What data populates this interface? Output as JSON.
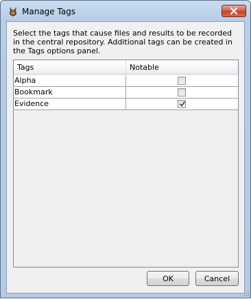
{
  "window": {
    "title": "Manage Tags",
    "close_glyph": "×"
  },
  "description": "Select the tags that cause files and results to be recorded in the central repository. Additional tags can be created in the Tags options panel.",
  "table": {
    "columns": [
      "Tags",
      "Notable"
    ],
    "rows": [
      {
        "tag": "Alpha",
        "notable": false
      },
      {
        "tag": "Bookmark",
        "notable": false
      },
      {
        "tag": "Evidence",
        "notable": true
      }
    ]
  },
  "buttons": {
    "ok": "OK",
    "cancel": "Cancel"
  },
  "icons": {
    "app": "autopsy-dog-icon",
    "close": "close-icon",
    "check": "check-icon",
    "resize": "resize-grip-icon"
  },
  "colors": {
    "close_button": "#c2432a",
    "titlebar": "#b7cde8",
    "table_background": "#ffffff"
  }
}
